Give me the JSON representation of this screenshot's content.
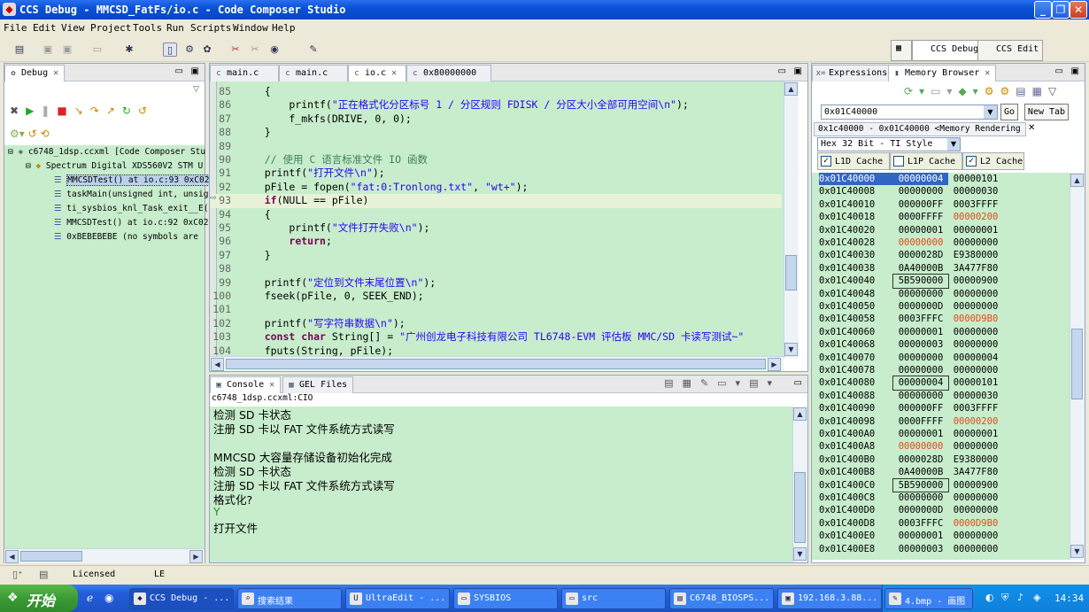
{
  "window": {
    "title": "CCS Debug - MMCSD_FatFs/io.c - Code Composer Studio"
  },
  "menu": [
    "File",
    "Edit",
    "View",
    "Project",
    "Tools",
    "Run",
    "Scripts",
    "Window",
    "Help"
  ],
  "perspectives": {
    "debug": "CCS Debug",
    "edit": "CCS Edit"
  },
  "debug_view": {
    "tab": "Debug",
    "tree": [
      {
        "label": "c6748_1dsp.ccxml [Code Composer Stu",
        "level": 0
      },
      {
        "label": "Spectrum Digital XDS560V2 STM U",
        "level": 1
      },
      {
        "label": "MMCSDTest() at io.c:93 0xC02",
        "level": 2,
        "selected": true
      },
      {
        "label": "taskMain(unsigned int, unsig",
        "level": 2
      },
      {
        "label": "ti_sysbios_knl_Task_exit__E(",
        "level": 2
      },
      {
        "label": "MMCSDTest() at io.c:92 0xC02",
        "level": 2
      },
      {
        "label": "0xBEBEBEBE  (no symbols are",
        "level": 2
      }
    ]
  },
  "editor": {
    "tabs": [
      {
        "label": "main.c",
        "active": false
      },
      {
        "label": "main.c",
        "active": false
      },
      {
        "label": "io.c",
        "active": true
      },
      {
        "label": "0x80000000",
        "active": false
      }
    ],
    "current_line": "93",
    "lines": [
      {
        "n": "85",
        "html": "    {"
      },
      {
        "n": "86",
        "html": "        printf(<span class=\"str\">\"正在格式化分区标号 1 / 分区规则 FDISK / 分区大小全部可用空间\\n\"</span>);"
      },
      {
        "n": "87",
        "html": "        f_mkfs(DRIVE, 0, 0);"
      },
      {
        "n": "88",
        "html": "    }"
      },
      {
        "n": "89",
        "html": ""
      },
      {
        "n": "90",
        "html": "    <span class=\"cm\">// 使用 C 语言标准文件 IO 函数</span>"
      },
      {
        "n": "91",
        "html": "    printf(<span class=\"str\">\"打开文件\\n\"</span>);"
      },
      {
        "n": "92",
        "html": "    pFile = fopen(<span class=\"str\">\"fat:0:Tronlong.txt\"</span>, <span class=\"str\">\"wt+\"</span>);"
      },
      {
        "n": "93",
        "html": "    <span class=\"kw\">if</span>(NULL == pFile)"
      },
      {
        "n": "94",
        "html": "    {"
      },
      {
        "n": "95",
        "html": "        printf(<span class=\"str\">\"文件打开失败\\n\"</span>);"
      },
      {
        "n": "96",
        "html": "        <span class=\"kw\">return</span>;"
      },
      {
        "n": "97",
        "html": "    }"
      },
      {
        "n": "98",
        "html": ""
      },
      {
        "n": "99",
        "html": "    printf(<span class=\"str\">\"定位到文件末尾位置\\n\"</span>);"
      },
      {
        "n": "100",
        "html": "    fseek(pFile, 0, SEEK_END);"
      },
      {
        "n": "101",
        "html": ""
      },
      {
        "n": "102",
        "html": "    printf(<span class=\"str\">\"写字符串数据\\n\"</span>);"
      },
      {
        "n": "103",
        "html": "    <span class=\"kw\">const</span> <span class=\"kw\">char</span> String[] = <span class=\"str\">\"广州创龙电子科技有限公司 TL6748-EVM 评估板 MMC/SD 卡读写测试~\"</span>"
      },
      {
        "n": "104",
        "html": "    fputs(String, pFile);"
      }
    ]
  },
  "console": {
    "tabs": [
      "Console",
      "GEL Files"
    ],
    "header": "c6748_1dsp.ccxml:CIO",
    "lines": [
      "检测 SD 卡状态",
      "注册 SD 卡以 FAT 文件系统方式读写",
      "",
      "MMCSD 大容量存储设备初始化完成",
      "检测 SD 卡状态",
      "注册 SD 卡以 FAT 文件系统方式读写",
      "格式化?",
      "Y",
      "打开文件"
    ]
  },
  "memory": {
    "tabs": [
      "Expressions",
      "Memory Browser"
    ],
    "address_input": "0x01C40000",
    "go_label": "Go",
    "newtab_label": "New Tab",
    "rendering_tab": "0x1c40000 - 0x01C40000 <Memory Rendering 1>",
    "format": "Hex 32 Bit - TI Style",
    "caches": [
      {
        "label": "L1D Cache",
        "checked": true
      },
      {
        "label": "L1P Cache",
        "checked": false
      },
      {
        "label": "L2 Cache",
        "checked": true
      }
    ],
    "rows": [
      [
        "0x01C40000",
        "00000004",
        "00000101"
      ],
      [
        "0x01C40008",
        "00000000",
        "00000030"
      ],
      [
        "0x01C40010",
        "000000FF",
        "0003FFFF"
      ],
      [
        "0x01C40018",
        "0000FFFF",
        "00000200"
      ],
      [
        "0x01C40020",
        "00000001",
        "00000001"
      ],
      [
        "0x01C40028",
        "00000000",
        "00000000"
      ],
      [
        "0x01C40030",
        "0000028D",
        "E9380000"
      ],
      [
        "0x01C40038",
        "0A40000B",
        "3A477F80"
      ],
      [
        "0x01C40040",
        "5B590000",
        "00000900"
      ],
      [
        "0x01C40048",
        "00000000",
        "00000000"
      ],
      [
        "0x01C40050",
        "0000000D",
        "00000000"
      ],
      [
        "0x01C40058",
        "0003FFFC",
        "0000D9B0"
      ],
      [
        "0x01C40060",
        "00000001",
        "00000000"
      ],
      [
        "0x01C40068",
        "00000003",
        "00000000"
      ],
      [
        "0x01C40070",
        "00000000",
        "00000004"
      ],
      [
        "0x01C40078",
        "00000000",
        "00000000"
      ],
      [
        "0x01C40080",
        "00000004",
        "00000101"
      ],
      [
        "0x01C40088",
        "00000000",
        "00000030"
      ],
      [
        "0x01C40090",
        "000000FF",
        "0003FFFF"
      ],
      [
        "0x01C40098",
        "0000FFFF",
        "00000200"
      ],
      [
        "0x01C400A0",
        "00000001",
        "00000001"
      ],
      [
        "0x01C400A8",
        "00000000",
        "00000000"
      ],
      [
        "0x01C400B0",
        "0000028D",
        "E9380000"
      ],
      [
        "0x01C400B8",
        "0A40000B",
        "3A477F80"
      ],
      [
        "0x01C400C0",
        "5B590000",
        "00000900"
      ],
      [
        "0x01C400C8",
        "00000000",
        "00000000"
      ],
      [
        "0x01C400D0",
        "0000000D",
        "00000000"
      ],
      [
        "0x01C400D8",
        "0003FFFC",
        "0000D9B0"
      ],
      [
        "0x01C400E0",
        "00000001",
        "00000000"
      ],
      [
        "0x01C400E8",
        "00000003",
        "00000000"
      ]
    ]
  },
  "status": {
    "licensed": "Licensed",
    "mode": "LE"
  },
  "taskbar": {
    "start": "开始",
    "tasks": [
      "CCS Debug - ...",
      "搜索结果",
      "UltraEdit - ...",
      "SYSBIOS",
      "src",
      "C6748_BIOSPS...",
      "192.168.3.88...",
      "4.bmp - 画图"
    ],
    "clock": "14:34"
  },
  "colors": {
    "editor_bg": "#c7edcc",
    "titlebar": "#0a52d6",
    "taskbar": "#245edb",
    "memory_changed": "#e64a19"
  }
}
